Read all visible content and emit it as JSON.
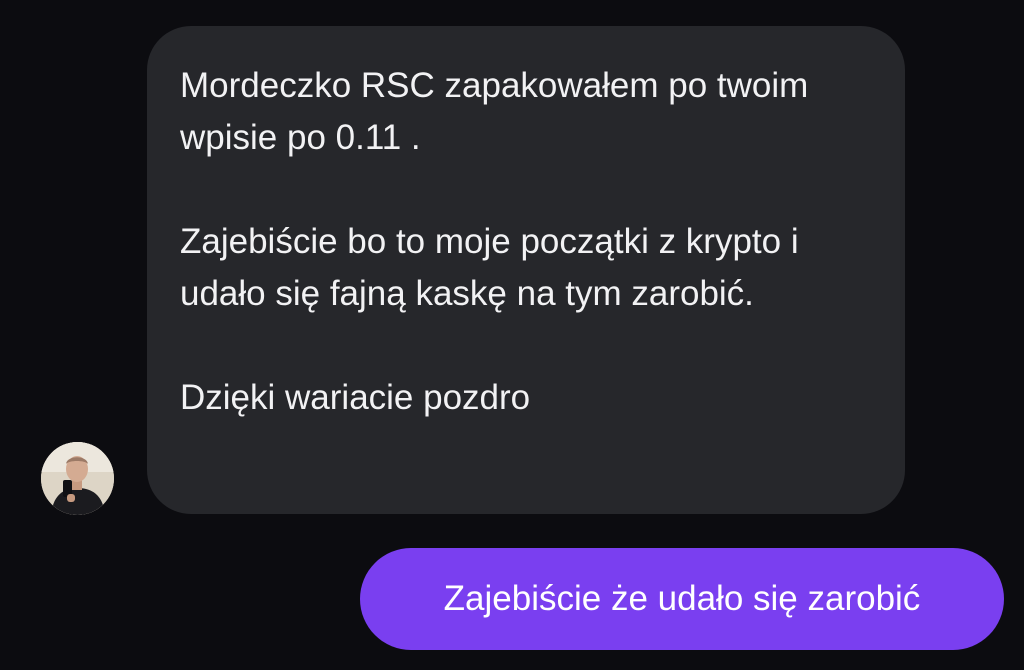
{
  "messages": {
    "incoming": {
      "paragraphs": [
        "Mordeczko RSC zapakowałem po twoim wpisie po 0.11 .",
        "Zajebiście bo to moje początki z krypto i udało się fajną kaskę na tym zarobić.",
        "Dzięki wariacie pozdro"
      ],
      "avatar_icon": "user-avatar-photo"
    },
    "outgoing": {
      "text": "Zajebiście że udało się zarobić"
    }
  },
  "colors": {
    "background": "#0c0c10",
    "incoming_bubble": "#26272b",
    "outgoing_bubble": "#7a3ff0",
    "text": "#f2f2f4"
  }
}
